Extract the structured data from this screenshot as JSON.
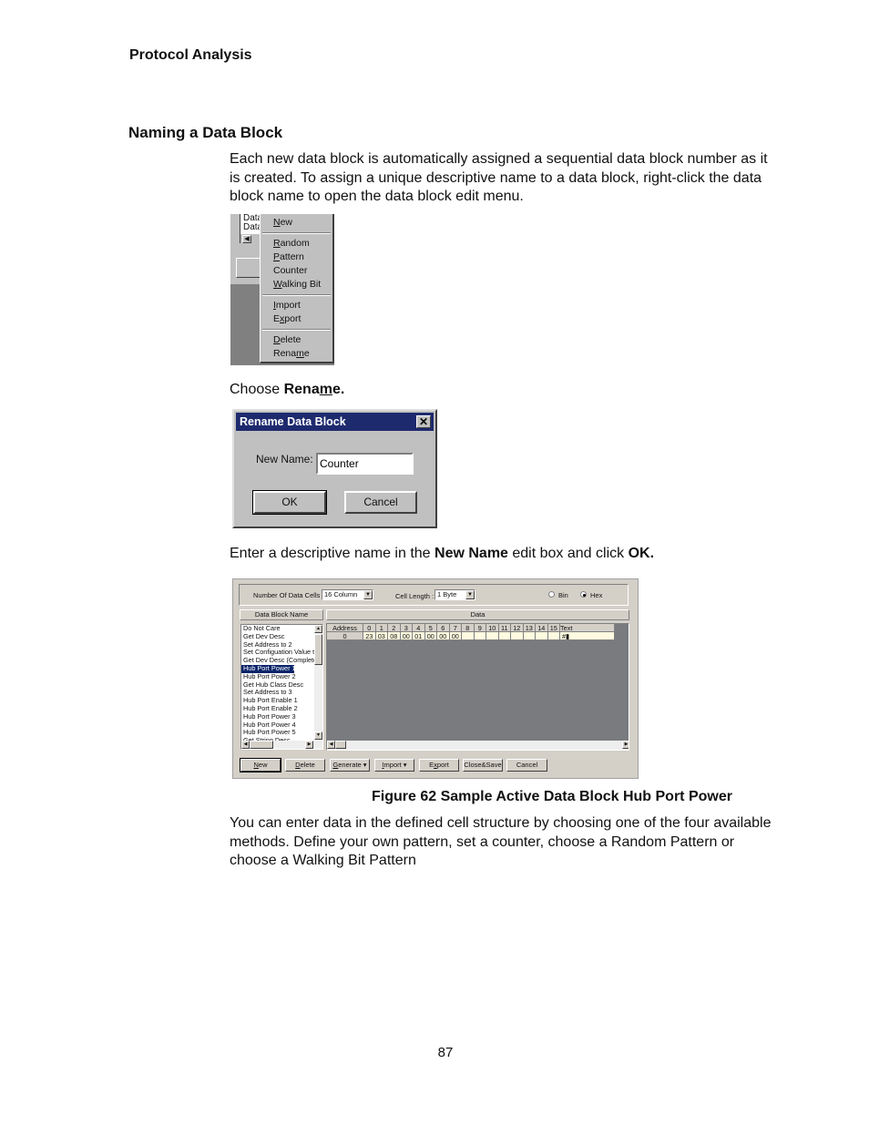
{
  "running_head": "Protocol Analysis",
  "section_title": "Naming a Data Block",
  "paragraphs": {
    "intro": "Each new data block is automatically assigned a sequential data block number as it is created. To assign a unique descriptive name to a data block, right-click the data block name to open the data block edit menu.",
    "choose_prefix": "Choose ",
    "choose_bold_pre": "Rena",
    "choose_bold_u": "m",
    "choose_bold_post": "e.",
    "enter_prefix": "Enter a descriptive name in the ",
    "enter_bold1": "New Name",
    "enter_mid": " edit box and click ",
    "enter_bold2": "OK.",
    "closing": "You can enter data in the defined cell structure by choosing one of the four available methods. Define your own pattern, set a counter, choose a Random Pattern or choose a Walking Bit Pattern"
  },
  "context_menu": {
    "behind_list": [
      "Data",
      "Data"
    ],
    "items": [
      {
        "pre": "",
        "u": "N",
        "post": "ew"
      },
      {
        "pre": "",
        "u": "R",
        "post": "andom"
      },
      {
        "pre": "",
        "u": "P",
        "post": "attern"
      },
      {
        "pre": "Counter",
        "u": "",
        "post": ""
      },
      {
        "pre": "",
        "u": "W",
        "post": "alking Bit"
      },
      {
        "pre": "",
        "u": "I",
        "post": "mport"
      },
      {
        "pre": "E",
        "u": "x",
        "post": "port"
      },
      {
        "pre": "",
        "u": "D",
        "post": "elete"
      },
      {
        "pre": "Rena",
        "u": "m",
        "post": "e"
      }
    ]
  },
  "rename_dialog": {
    "title": "Rename Data Block",
    "close_glyph": "✕",
    "label": "New Name:",
    "value": "Counter",
    "ok": "OK",
    "cancel": "Cancel"
  },
  "data_block_window": {
    "num_cells_label": "Number Of Data Cells :",
    "num_cells_value": "16 Column",
    "cell_length_label": "Cell Length :",
    "cell_length_value": "1  Byte",
    "radio_bin": "Bin",
    "radio_hex": "Hex",
    "selected_format": "Hex",
    "list_header": "Data Block Name",
    "data_header": "Data",
    "list_items": [
      "Do Not Care",
      "Get Dev Desc",
      "Set Address to 2",
      "Set Configuation Value to",
      "Get Dev Desc (Complete)",
      "Hub Port Power 1",
      "Hub Port Power 2",
      "Get Hub Class Desc",
      "Set Address to 3",
      "Hub Port Enable 1",
      "Hub Port Enable 2",
      "Hub Port Power 3",
      "Hub Port Power 4",
      "Hub Port Power 5",
      "Get String Desc"
    ],
    "selected_item": "Hub Port Power 1",
    "grid_headers": [
      "Address",
      "0",
      "1",
      "2",
      "3",
      "4",
      "5",
      "6",
      "7",
      "8",
      "9",
      "10",
      "11",
      "12",
      "13",
      "14",
      "15",
      "Text"
    ],
    "grid_row": [
      "0",
      "23",
      "03",
      "08",
      "00",
      "01",
      "00",
      "00",
      "00",
      "",
      "",
      "",
      "",
      "",
      "",
      "",
      "",
      "#▮"
    ],
    "buttons": {
      "new": {
        "pre": "",
        "u": "N",
        "post": "ew"
      },
      "delete": {
        "pre": "",
        "u": "D",
        "post": "elete"
      },
      "generate": {
        "pre": "",
        "u": "G",
        "post": "enerate ▾"
      },
      "import": {
        "pre": "",
        "u": "I",
        "post": "mport  ▾"
      },
      "export": {
        "pre": "E",
        "u": "x",
        "post": "port"
      },
      "close_save": "Close&Save",
      "cancel": "Cancel"
    }
  },
  "figure_caption": "Figure  62  Sample Active Data Block Hub Port Power",
  "page_number": "87",
  "icons": {
    "dropdown": "▼",
    "scroll_up": "▲",
    "scroll_down": "▼",
    "scroll_left": "◀",
    "scroll_right": "▶"
  }
}
